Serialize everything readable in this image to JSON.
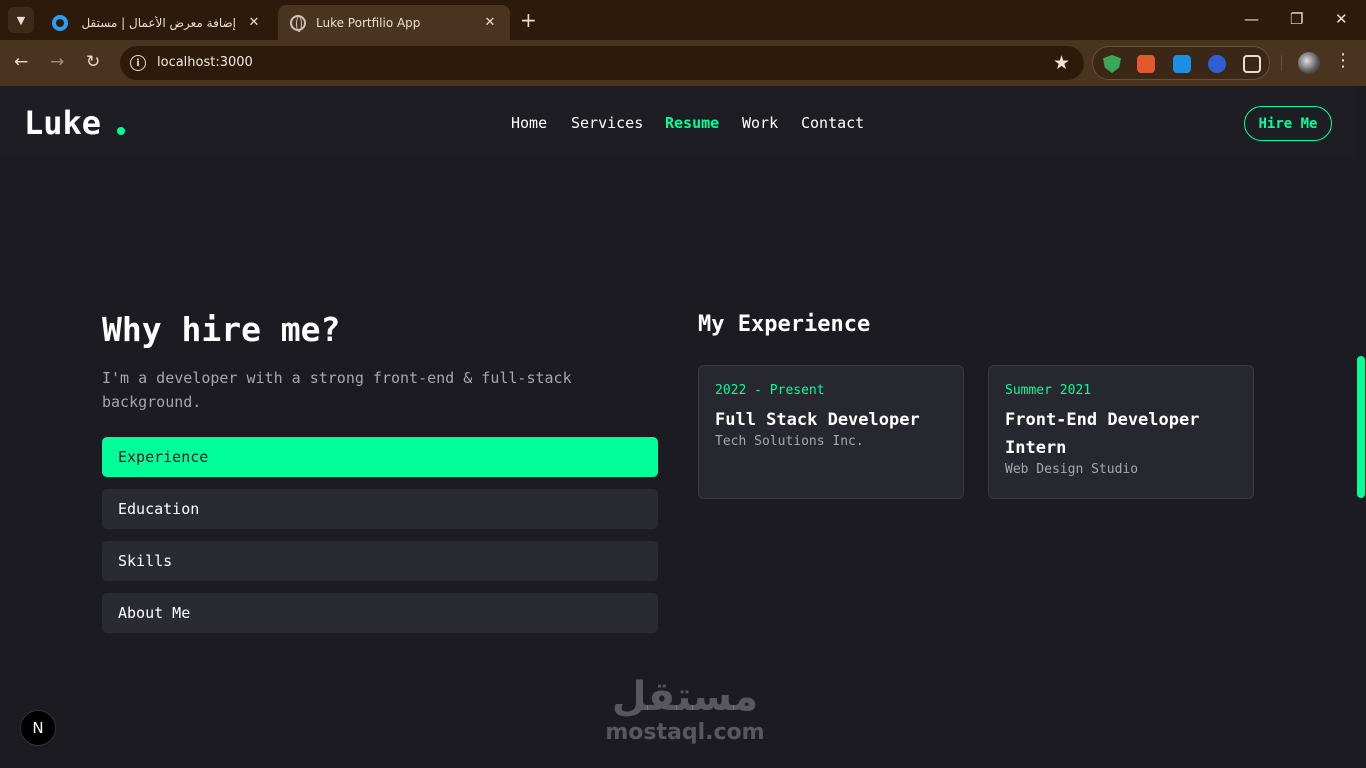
{
  "browser": {
    "tabs": [
      {
        "title": "إضافة معرض الأعمال | مستقل",
        "icon": "mostaql-favicon"
      },
      {
        "title": "Luke Portfilio App",
        "icon": "globe-icon"
      }
    ],
    "url": "localhost:3000"
  },
  "site": {
    "logo": "Luke",
    "nav": [
      "Home",
      "Services",
      "Resume",
      "Work",
      "Contact"
    ],
    "active_nav": "Resume",
    "hire_button": "Hire Me",
    "accent_color": "#00ff99"
  },
  "resume": {
    "title": "Why hire me?",
    "description": "I'm a developer with a strong front-end & full-stack background.",
    "tabs": [
      "Experience",
      "Education",
      "Skills",
      "About Me"
    ],
    "selected_tab": "Experience",
    "section_title": "My Experience",
    "items": [
      {
        "date": "2022 - Present",
        "role": "Full Stack Developer",
        "company": "Tech Solutions Inc."
      },
      {
        "date": "Summer 2021",
        "role": "Front-End Developer Intern",
        "company": "Web Design Studio"
      }
    ]
  },
  "overlay": {
    "nextjs_badge": "N",
    "watermark_arabic": "مستقل",
    "watermark_latin": "mostaql.com"
  }
}
